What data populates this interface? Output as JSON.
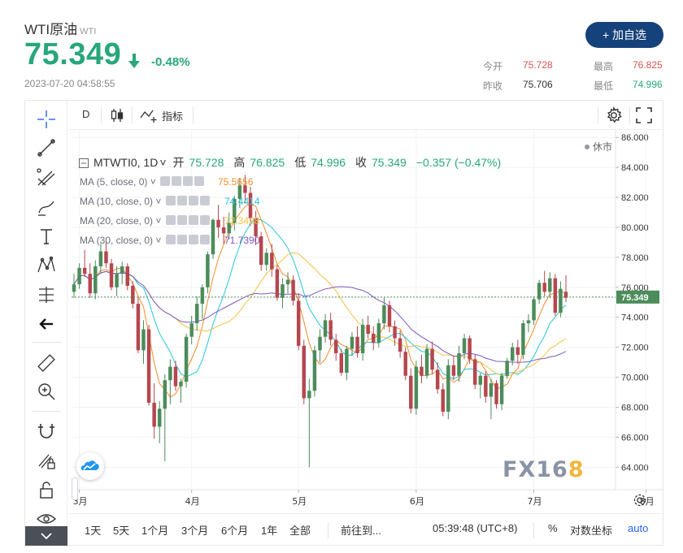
{
  "header": {
    "title": "WTI原油",
    "code": "WTI",
    "price": "75.349",
    "change": "-0.48%",
    "timestamp": "2023-07-20 04:58:55",
    "add_button": "+ 加自选",
    "stats": {
      "open_label": "今开",
      "open_value": "75.728",
      "high_label": "最高",
      "high_value": "76.825",
      "prev_label": "昨收",
      "prev_value": "75.706",
      "low_label": "最低",
      "low_value": "74.996"
    }
  },
  "toolbar": {
    "interval": "D",
    "indicators_label": "指标"
  },
  "legend": {
    "symbol": "MTWTI0, 1D",
    "open_label": "开",
    "open": "75.728",
    "high_label": "高",
    "high": "76.825",
    "low_label": "低",
    "low": "74.996",
    "close_label": "收",
    "close": "75.349",
    "change": "−0.357 (−0.47%)",
    "market_status": "休市",
    "ma": [
      {
        "label": "MA (5, close, 0)",
        "value": "75.5656",
        "color": "#f48b2a"
      },
      {
        "label": "MA (10, close, 0)",
        "value": "74.4414",
        "color": "#26c6da"
      },
      {
        "label": "MA (20, close, 0)",
        "value": "72.3428",
        "color": "#f5c242"
      },
      {
        "label": "MA (30, close, 0)",
        "value": "71.7390",
        "color": "#7e57c2"
      }
    ]
  },
  "watermark": {
    "main": "FX16",
    "last": "8"
  },
  "bottom_bar": {
    "ranges": [
      "1天",
      "5天",
      "1个月",
      "3个月",
      "6个月",
      "1年",
      "全部"
    ],
    "goto": "前往到...",
    "clock": "05:39:48 (UTC+8)",
    "percent": "%",
    "log": "对数坐标",
    "auto": "auto"
  },
  "colors": {
    "up": "#4b8c5a",
    "down": "#b5474f",
    "accent": "#15427a"
  },
  "chart_data": {
    "type": "candlestick",
    "y_axis_ticks": [
      "86.000",
      "84.000",
      "82.000",
      "80.000",
      "78.000",
      "76.000",
      "74.000",
      "72.000",
      "70.000",
      "68.000",
      "66.000",
      "64.000"
    ],
    "ylim": [
      62.5,
      86.5
    ],
    "x_ticks": [
      "3月",
      "4月",
      "5月",
      "6月",
      "7月",
      "8月"
    ],
    "last_price_label": "75.349",
    "candles": [
      [
        75.7,
        76.9,
        75.3,
        76.2
      ],
      [
        76.2,
        77.6,
        75.9,
        77.3
      ],
      [
        77.3,
        78.5,
        76.7,
        76.9
      ],
      [
        76.9,
        77.6,
        75.3,
        75.6
      ],
      [
        75.6,
        77.8,
        75.2,
        77.4
      ],
      [
        77.4,
        78.9,
        76.9,
        78.4
      ],
      [
        78.4,
        79.1,
        77.3,
        77.6
      ],
      [
        77.6,
        77.9,
        75.8,
        76.0
      ],
      [
        76.0,
        77.4,
        75.4,
        76.9
      ],
      [
        76.9,
        77.7,
        76.2,
        77.4
      ],
      [
        77.4,
        77.6,
        75.8,
        76.1
      ],
      [
        76.1,
        76.4,
        74.6,
        74.9
      ],
      [
        74.9,
        75.3,
        71.6,
        71.8
      ],
      [
        71.8,
        73.8,
        70.9,
        73.2
      ],
      [
        73.2,
        73.5,
        68.1,
        68.3
      ],
      [
        68.3,
        69.6,
        65.9,
        66.7
      ],
      [
        66.7,
        68.4,
        65.6,
        67.9
      ],
      [
        67.9,
        70.2,
        64.4,
        69.8
      ],
      [
        69.8,
        71.2,
        68.2,
        70.7
      ],
      [
        70.7,
        71.1,
        69.1,
        69.4
      ],
      [
        69.4,
        69.9,
        68.3,
        69.7
      ],
      [
        69.7,
        72.9,
        69.3,
        72.7
      ],
      [
        72.7,
        74.1,
        72.2,
        73.6
      ],
      [
        73.6,
        75.4,
        73.1,
        74.9
      ],
      [
        74.9,
        76.2,
        73.9,
        76.0
      ],
      [
        76.0,
        78.4,
        75.6,
        78.2
      ],
      [
        78.2,
        80.6,
        77.9,
        80.5
      ],
      [
        80.5,
        81.5,
        79.3,
        80.0
      ],
      [
        80.0,
        80.7,
        78.9,
        79.6
      ],
      [
        79.6,
        81.0,
        79.2,
        80.3
      ],
      [
        80.3,
        82.1,
        79.8,
        81.9
      ],
      [
        81.9,
        83.3,
        81.3,
        82.8
      ],
      [
        82.8,
        83.5,
        81.6,
        82.3
      ],
      [
        82.3,
        82.7,
        80.1,
        80.6
      ],
      [
        80.6,
        81.1,
        78.8,
        79.4
      ],
      [
        79.4,
        79.7,
        77.1,
        77.5
      ],
      [
        77.5,
        78.6,
        77.1,
        78.3
      ],
      [
        78.3,
        78.9,
        76.7,
        77.2
      ],
      [
        77.2,
        77.5,
        75.1,
        75.3
      ],
      [
        75.3,
        76.6,
        74.6,
        76.2
      ],
      [
        76.2,
        77.0,
        75.6,
        76.5
      ],
      [
        76.5,
        76.8,
        74.8,
        75.1
      ],
      [
        75.1,
        75.6,
        71.8,
        72.1
      ],
      [
        72.1,
        72.5,
        68.2,
        68.6
      ],
      [
        68.6,
        69.9,
        64.0,
        69.1
      ],
      [
        69.1,
        72.1,
        68.7,
        71.8
      ],
      [
        71.8,
        73.2,
        71.0,
        72.7
      ],
      [
        72.7,
        74.2,
        72.3,
        73.8
      ],
      [
        73.8,
        74.3,
        72.1,
        72.5
      ],
      [
        72.5,
        72.9,
        71.1,
        71.6
      ],
      [
        71.6,
        71.9,
        70.1,
        70.3
      ],
      [
        70.3,
        72.1,
        69.8,
        71.9
      ],
      [
        71.9,
        73.0,
        71.4,
        72.7
      ],
      [
        72.7,
        73.4,
        71.3,
        71.6
      ],
      [
        71.6,
        73.9,
        71.1,
        73.5
      ],
      [
        73.5,
        74.1,
        72.6,
        72.9
      ],
      [
        72.9,
        73.4,
        71.8,
        72.3
      ],
      [
        72.3,
        73.9,
        72.0,
        73.6
      ],
      [
        73.6,
        75.3,
        73.2,
        74.8
      ],
      [
        74.8,
        75.1,
        73.0,
        73.4
      ],
      [
        73.4,
        73.8,
        72.1,
        72.6
      ],
      [
        72.6,
        73.1,
        71.3,
        71.7
      ],
      [
        71.7,
        72.0,
        69.8,
        70.1
      ],
      [
        70.1,
        70.6,
        67.6,
        67.9
      ],
      [
        67.9,
        71.1,
        67.5,
        70.7
      ],
      [
        70.7,
        71.5,
        69.6,
        70.1
      ],
      [
        70.1,
        72.2,
        69.9,
        71.9
      ],
      [
        71.9,
        72.4,
        70.2,
        70.5
      ],
      [
        70.5,
        71.0,
        68.9,
        69.2
      ],
      [
        69.2,
        69.6,
        67.4,
        67.7
      ],
      [
        67.7,
        71.2,
        67.2,
        70.8
      ],
      [
        70.8,
        71.4,
        69.8,
        70.1
      ],
      [
        70.1,
        72.1,
        69.7,
        71.6
      ],
      [
        71.6,
        72.9,
        71.2,
        72.6
      ],
      [
        72.6,
        72.8,
        70.9,
        71.2
      ],
      [
        71.2,
        71.5,
        69.2,
        69.5
      ],
      [
        69.5,
        70.3,
        68.6,
        70.1
      ],
      [
        70.1,
        70.4,
        68.3,
        68.7
      ],
      [
        68.7,
        69.9,
        67.2,
        69.6
      ],
      [
        69.6,
        69.8,
        67.9,
        68.2
      ],
      [
        68.2,
        70.3,
        67.8,
        70.1
      ],
      [
        70.1,
        71.3,
        69.9,
        71.1
      ],
      [
        71.1,
        72.3,
        70.8,
        72.0
      ],
      [
        72.0,
        72.5,
        70.9,
        71.5
      ],
      [
        71.5,
        73.8,
        71.2,
        73.6
      ],
      [
        73.6,
        74.2,
        73.0,
        73.8
      ],
      [
        73.8,
        75.4,
        73.5,
        75.2
      ],
      [
        75.2,
        76.5,
        74.9,
        76.3
      ],
      [
        76.3,
        77.1,
        75.4,
        75.7
      ],
      [
        75.7,
        77.0,
        75.3,
        76.6
      ],
      [
        76.6,
        76.9,
        74.1,
        74.3
      ],
      [
        74.3,
        76.4,
        74.0,
        75.9
      ],
      [
        75.7,
        76.8,
        75.0,
        75.3
      ]
    ]
  }
}
